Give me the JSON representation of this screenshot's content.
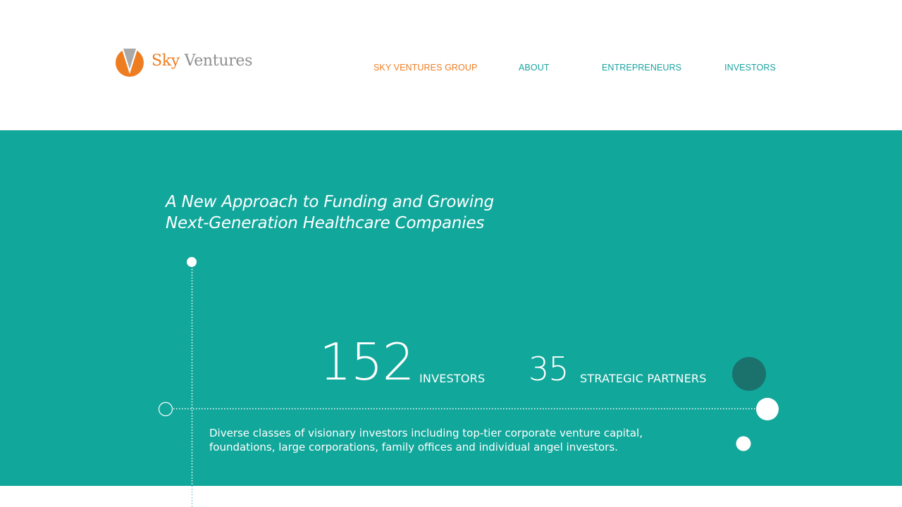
{
  "brand": {
    "name_part1": "Sky",
    "name_part2": "Ventures",
    "logo_icon": "v-logo-icon",
    "colors": {
      "orange": "#ee7d22",
      "grey": "#8e8e8e"
    }
  },
  "nav": {
    "items": [
      {
        "label": "SKY VENTURES GROUP",
        "active": true
      },
      {
        "label": "ABOUT",
        "active": false
      },
      {
        "label": "ENTREPRENEURS",
        "active": false
      },
      {
        "label": "INVESTORS",
        "active": false
      }
    ],
    "colors": {
      "active": "#ee7d22",
      "default": "#1aa3a0"
    }
  },
  "hero": {
    "background": "#12a79b",
    "headline_line1": "A New Approach to Funding and Growing",
    "headline_line2": "Next-Generation Healthcare Companies",
    "stats": [
      {
        "number": "152",
        "label": "INVESTORS"
      },
      {
        "number": "35",
        "label": "STRATEGIC PARTNERS"
      }
    ],
    "description_line1": "Diverse classes of visionary investors including top-tier corporate venture capital,",
    "description_line2": "foundations, large corporations, family offices and individual angel investors."
  }
}
